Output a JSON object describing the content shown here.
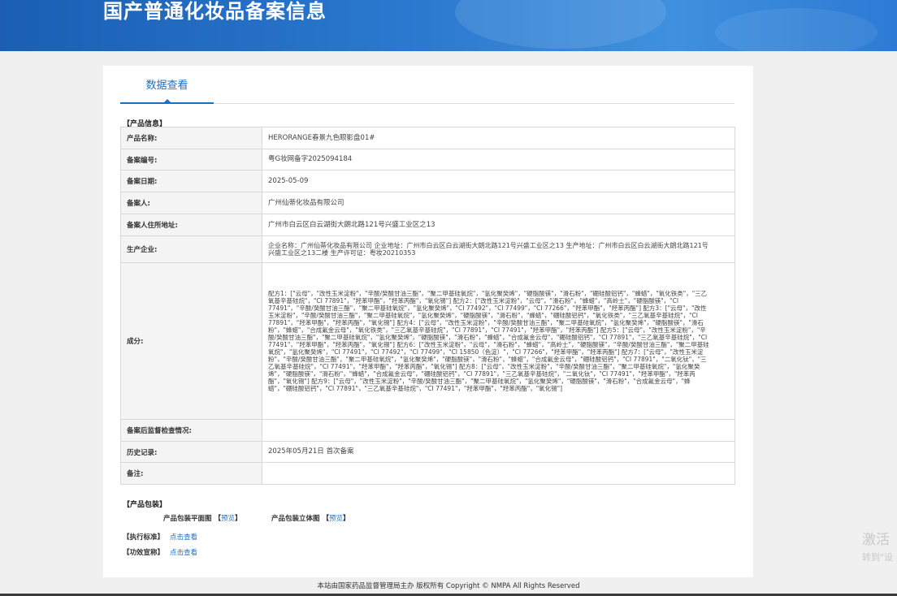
{
  "header": {
    "title": "国产普通化妆品备案信息"
  },
  "tab": {
    "label": "数据查看"
  },
  "product_info": {
    "section_title": "【产品信息】",
    "rows": [
      {
        "label": "产品名称:",
        "value": "HERORANGE春景九色眼影盘01#"
      },
      {
        "label": "备案编号:",
        "value": "粤G妆网备字2025094184"
      },
      {
        "label": "备案日期:",
        "value": "2025-05-09"
      },
      {
        "label": "备案人:",
        "value": "广州仙蒂化妆品有限公司"
      },
      {
        "label": "备案人住所地址:",
        "value": "广州市白云区白云湖街大朗北路121号兴盛工业区之13"
      },
      {
        "label": "生产企业:",
        "value": "企业名称：广州仙蒂化妆品有限公司 企业地址：广州市白云区白云湖街大朗北路121号兴盛工业区之13 生产地址：广州市白云区白云湖街大朗北路121号 兴盛工业区之13二楼 生产许可证：粤妆20210353"
      },
      {
        "label": "成分:",
        "value": "配方1：[\"云母\"，\"改性玉米淀粉\"，\"辛酸/癸酸甘油三酯\"，\"聚二甲基硅氧烷\"，\"氢化聚癸烯\"，\"硬脂酸镁\"，\"滑石粉\"，\"硼硅酸铝钙\"，\"蜂蜡\"，\"氧化铁类\"，\"三乙氧基辛基硅烷\"，\"CI 77891\"，\"羟苯甲酯\"，\"羟苯丙酯\"，\"氧化锡\"] 配方2：[\"改性玉米淀粉\"，\"云母\"，\"滑石粉\"，\"蜂蜡\"，\"高岭土\"，\"硬脂酸镁\"，\"CI 77491\"，\"辛酸/癸酸甘油三酯\"，\"聚二甲基硅氧烷\"，\"氢化聚癸烯\"，\"CI 77492\"，\"CI 77499\"，\"CI 77266\"，\"羟苯甲酯\"，\"羟苯丙酯\"] 配方3：[\"云母\"，\"改性玉米淀粉\"，\"辛酸/癸酸甘油三酯\"，\"聚二甲基硅氧烷\"，\"氢化聚癸烯\"，\"硬脂酸镁\"，\"滑石粉\"，\"蜂蜡\"，\"硼硅酸铝钙\"，\"氧化铁类\"，\"三乙氧基辛基硅烷\"，\"CI 77891\"，\"羟苯甲酯\"，\"羟苯丙酯\"，\"氧化锡\"] 配方4：[\"云母\"，\"改性玉米淀粉\"，\"辛酸/癸酸甘油三酯\"，\"聚二甲基硅氧烷\"，\"氢化聚癸烯\"，\"硬脂酸镁\"，\"滑石粉\"，\"蜂蜡\"，\"合成氟金云母\"，\"氧化铁类\"，\"三乙氧基辛基硅烷\"，\"CI 77891\"，\"CI 77491\"，\"羟苯甲酯\"，\"羟苯丙酯\"] 配方5：[\"云母\"，\"改性玉米淀粉\"，\"辛酸/癸酸甘油三酯\"，\"聚二甲基硅氧烷\"，\"氢化聚癸烯\"，\"硬脂酸镁\"，\"滑石粉\"，\"蜂蜡\"，\"合成氟金云母\"，\"硼硅酸铝钙\"，\"CI 77891\"，\"三乙氧基辛基硅烷\"，\"CI 77491\"，\"羟苯甲酯\"，\"羟苯丙酯\"，\"氧化锡\"] 配方6：[\"改性玉米淀粉\"，\"云母\"，\"滑石粉\"，\"蜂蜡\"，\"高岭土\"，\"硬脂酸镁\"，\"辛酸/癸酸甘油三酯\"，\"聚二甲基硅氧烷\"，\"氢化聚癸烯\"，\"CI 77491\"，\"CI 77492\"，\"CI 77499\"，\"CI 15850（色淀）\"，\"CI 77266\"，\"羟苯甲酯\"，\"羟苯丙酯\"] 配方7：[\"云母\"，\"改性玉米淀粉\"，\"辛酸/癸酸甘油三酯\"，\"聚二甲基硅氧烷\"，\"氢化聚癸烯\"，\"硬脂酸镁\"，\"滑石粉\"，\"蜂蜡\"，\"合成氟金云母\"，\"硼硅酸铝钙\"，\"CI 77891\"，\"二氧化钛\"，\"三乙氧基辛基硅烷\"，\"CI 77491\"，\"羟苯甲酯\"，\"羟苯丙酯\"，\"氧化锡\"] 配方8：[\"云母\"，\"改性玉米淀粉\"，\"辛酸/癸酸甘油三酯\"，\"聚二甲基硅氧烷\"，\"氢化聚癸烯\"，\"硬脂酸镁\"，\"滑石粉\"，\"蜂蜡\"，\"合成氟金云母\"，\"硼硅酸铝钙\"，\"CI 77891\"，\"三乙氧基辛基硅烷\"，\"二氧化钛\"，\"CI 77491\"，\"羟苯甲酯\"，\"羟苯丙酯\"，\"氧化锡\"] 配方9：[\"云母\"，\"改性玉米淀粉\"，\"辛酸/癸酸甘油三酯\"，\"聚二甲基硅氧烷\"，\"氢化聚癸烯\"，\"硬脂酸镁\"，\"滑石粉\"，\"合成氟金云母\"，\"蜂蜡\"，\"硼硅酸铝钙\"，\"CI 77891\"，\"三乙氧基辛基硅烷\"，\"CI 77491\"，\"羟苯甲酯\"，\"羟苯丙酯\"，\"氧化锡\"]"
      },
      {
        "label": "备案后监督检查情况:",
        "value": ""
      },
      {
        "label": "历史记录:",
        "value": "2025年05月21日 首次备案"
      },
      {
        "label": "备注:",
        "value": ""
      }
    ]
  },
  "packaging": {
    "section_title": "【产品包装】",
    "flat_label": "产品包装平面图",
    "solid_label": "产品包装立体图",
    "preview_open": "【",
    "preview_text": "预览",
    "preview_close": "】"
  },
  "standards": {
    "label": "【执行标准】",
    "link": "点击查看"
  },
  "efficacy": {
    "label": "【功效宣称】",
    "link": "点击查看"
  },
  "footer": {
    "text": "本站由国家药品监督管理局主办 版权所有 Copyright © NMPA All Rights Reserved"
  },
  "watermark": {
    "line1": "激活",
    "line2": "转到\"设"
  }
}
